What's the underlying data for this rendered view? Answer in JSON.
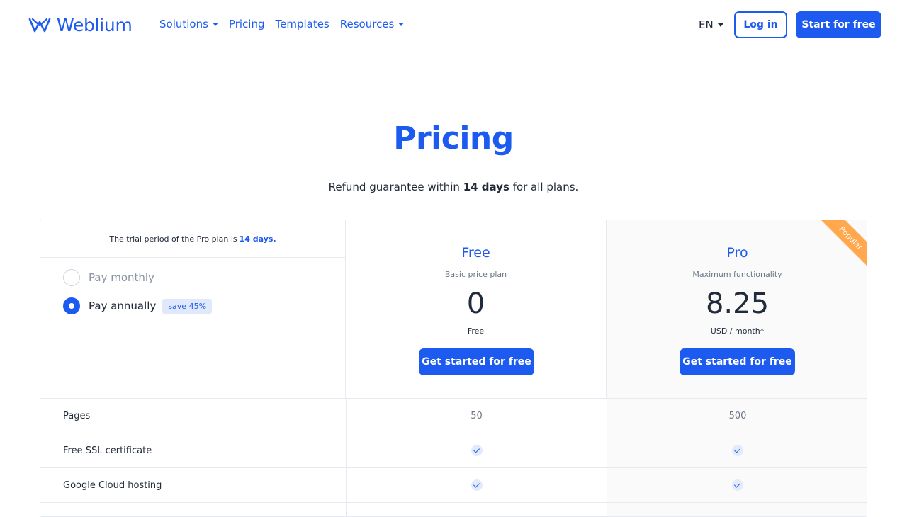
{
  "header": {
    "logo_text": "Weblium",
    "nav": [
      {
        "label": "Solutions",
        "dropdown": true
      },
      {
        "label": "Pricing",
        "dropdown": false
      },
      {
        "label": "Templates",
        "dropdown": false
      },
      {
        "label": "Resources",
        "dropdown": true
      }
    ],
    "language": "EN",
    "login_label": "Log in",
    "start_label": "Start for free"
  },
  "hero": {
    "title": "Pricing",
    "subtitle_before": "Refund guarantee within ",
    "subtitle_bold": "14 days",
    "subtitle_after": " for all plans."
  },
  "billing": {
    "trial_text": "The trial period of the Pro plan is",
    "trial_highlight": "14 days.",
    "monthly_label": "Pay monthly",
    "annually_label": "Pay annually",
    "save_badge": "save 45%",
    "selected": "annually"
  },
  "plans": {
    "free": {
      "name": "Free",
      "description": "Basic price plan",
      "price": "0",
      "period": "Free",
      "button": "Get started for free"
    },
    "pro": {
      "name": "Pro",
      "description": "Maximum functionality",
      "price": "8.25",
      "period": "USD / month*",
      "button": "Get started for free",
      "ribbon": "Popular"
    }
  },
  "features": [
    {
      "name": "Pages",
      "free": "50",
      "pro": "500"
    },
    {
      "name": "Free SSL certificate",
      "free": "check",
      "pro": "check"
    },
    {
      "name": "Google Cloud hosting",
      "free": "check",
      "pro": "check"
    }
  ],
  "colors": {
    "brand": "#1d5bf0",
    "ribbon": "#ffa84d",
    "badge_bg": "#dfe9fb"
  }
}
